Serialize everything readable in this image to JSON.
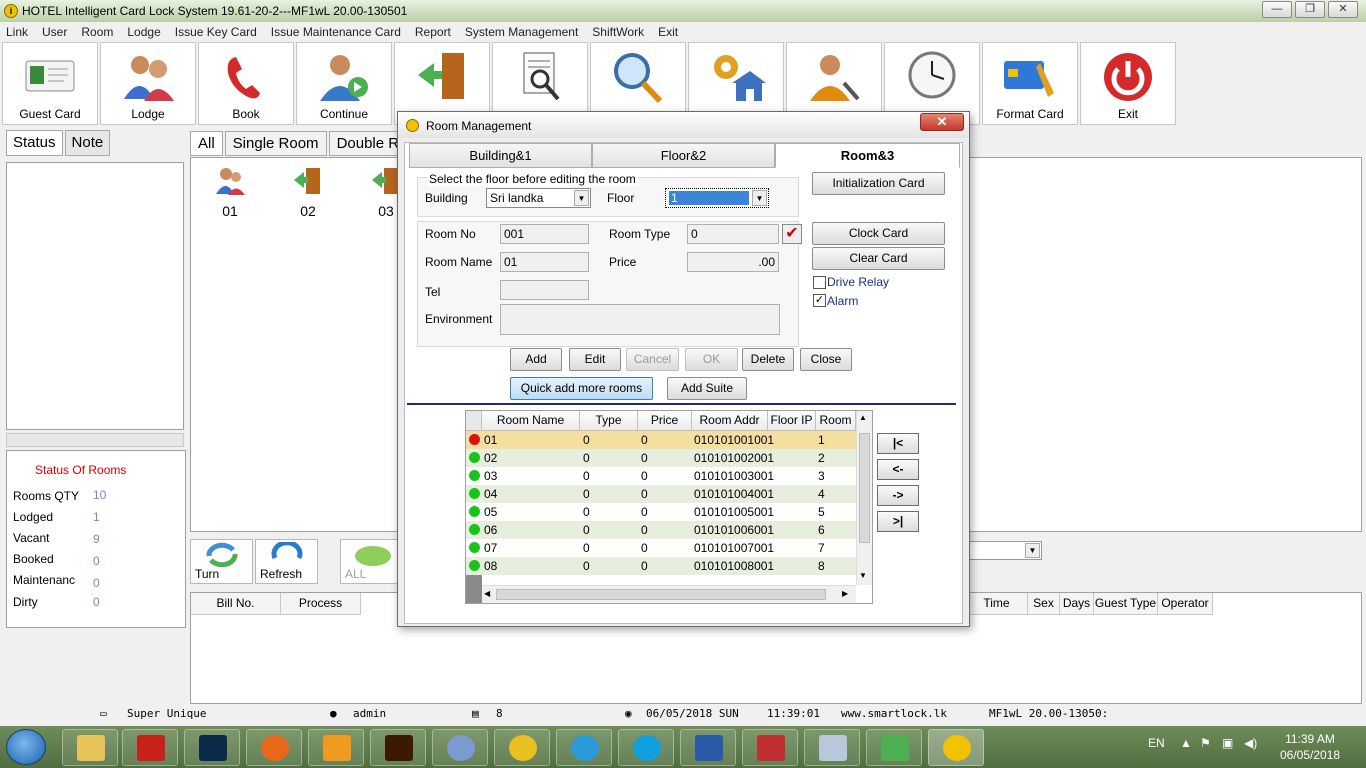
{
  "window": {
    "title": "HOTEL Intelligent Card Lock System 19.61-20-2---MF1wL 20.00-130501"
  },
  "menu": [
    "Link",
    "User",
    "Room",
    "Lodge",
    "Issue Key Card",
    "Issue Maintenance Card",
    "Report",
    "System Management",
    "ShiftWork",
    "Exit"
  ],
  "toolbar": [
    {
      "label": "Guest Card",
      "icon": "guest-card-icon"
    },
    {
      "label": "Lodge",
      "icon": "lodge-icon"
    },
    {
      "label": "Book",
      "icon": "book-phone-icon"
    },
    {
      "label": "Continue",
      "icon": "continue-icon"
    },
    {
      "label": "",
      "icon": "checkout-door-icon"
    },
    {
      "label": "",
      "icon": "report-icon"
    },
    {
      "label": "",
      "icon": "search-icon"
    },
    {
      "label": "",
      "icon": "room-settings-icon"
    },
    {
      "label": "",
      "icon": "user-tools-icon"
    },
    {
      "label": "",
      "icon": "clock-icon"
    },
    {
      "label": "Format Card",
      "icon": "format-card-icon"
    },
    {
      "label": "Exit",
      "icon": "power-icon"
    }
  ],
  "left_tabs": {
    "status": "Status",
    "note": "Note"
  },
  "status_of_rooms": {
    "title": "Status Of Rooms",
    "rows": [
      {
        "label": "Rooms QTY",
        "value": "10"
      },
      {
        "label": "Lodged",
        "value": "1"
      },
      {
        "label": "Vacant",
        "value": "9"
      },
      {
        "label": "Booked",
        "value": "0"
      },
      {
        "label": "Maintenanc",
        "value": "0"
      },
      {
        "label": "Dirty",
        "value": "0"
      }
    ]
  },
  "center_tabs": [
    "All",
    "Single Room",
    "Double Roo"
  ],
  "rooms": [
    {
      "number": "01",
      "icon": "occupied-room-icon"
    },
    {
      "number": "02",
      "icon": "vacant-room-icon"
    },
    {
      "number": "03",
      "icon": "vacant-room-icon"
    }
  ],
  "bottom_buttons": {
    "turn": "Turn",
    "refresh": "Refresh",
    "all": "ALL"
  },
  "bill_columns_left": [
    "Bill No.",
    "Process"
  ],
  "bill_columns_right": [
    "Time",
    "Sex",
    "Days",
    "Guest Type",
    "Operator"
  ],
  "statusbar": {
    "company": "Super Unique",
    "user": "admin",
    "count": "8",
    "date": "06/05/2018 SUN",
    "time": "11:39:01",
    "website": "www.smartlock.lk",
    "version": "MF1wL 20.00-13050:"
  },
  "taskbar": {
    "lang": "EN",
    "clock_time": "11:39 AM",
    "clock_date": "06/05/2018"
  },
  "dialog": {
    "title": "Room Management",
    "close": "✕",
    "tabs": [
      "Building&1",
      "Floor&2",
      "Room&3"
    ],
    "select_hint": "Select the floor before editing the room",
    "building_label": "Building",
    "building_value": "Sri landka",
    "floor_label": "Floor",
    "floor_value": "1",
    "room_no_label": "Room No",
    "room_no_value": "001",
    "room_type_label": "Room Type",
    "room_type_value": "0",
    "room_name_label": "Room Name",
    "room_name_value": "01",
    "price_label": "Price",
    "price_value": ".00",
    "tel_label": "Tel",
    "tel_value": "",
    "environment_label": "Environment",
    "environment_value": "",
    "init_card": "Initialization Card",
    "clock_card": "Clock Card",
    "clear_card": "Clear Card",
    "drive_relay": "Drive Relay",
    "drive_relay_checked": false,
    "alarm": "Alarm",
    "alarm_checked": true,
    "actions": {
      "add": "Add",
      "edit": "Edit",
      "cancel": "Cancel",
      "ok": "OK",
      "delete": "Delete",
      "close": "Close"
    },
    "quick_add": "Quick add more rooms",
    "add_suite": "Add Suite",
    "grid_columns": [
      "Room Name",
      "Type",
      "Price",
      "Room Addr",
      "Floor IP",
      "Room"
    ],
    "grid_rows": [
      {
        "name": "01",
        "type": "0",
        "price": "0",
        "addr": "010101001001",
        "room": "1",
        "status": "occupied"
      },
      {
        "name": "02",
        "type": "0",
        "price": "0",
        "addr": "010101002001",
        "room": "2",
        "status": "vacant"
      },
      {
        "name": "03",
        "type": "0",
        "price": "0",
        "addr": "010101003001",
        "room": "3",
        "status": "vacant"
      },
      {
        "name": "04",
        "type": "0",
        "price": "0",
        "addr": "010101004001",
        "room": "4",
        "status": "vacant"
      },
      {
        "name": "05",
        "type": "0",
        "price": "0",
        "addr": "010101005001",
        "room": "5",
        "status": "vacant"
      },
      {
        "name": "06",
        "type": "0",
        "price": "0",
        "addr": "010101006001",
        "room": "6",
        "status": "vacant"
      },
      {
        "name": "07",
        "type": "0",
        "price": "0",
        "addr": "010101007001",
        "room": "7",
        "status": "vacant"
      },
      {
        "name": "08",
        "type": "0",
        "price": "0",
        "addr": "010101008001",
        "room": "8",
        "status": "vacant"
      }
    ],
    "nav": {
      "first": "|<",
      "prev": "<-",
      "next": "->",
      "last": ">|"
    }
  },
  "colors": {
    "occupied": "#e01010",
    "vacant": "#19c419",
    "selected_row": "#f5dfa0",
    "alt_row": "#e8eedd"
  }
}
